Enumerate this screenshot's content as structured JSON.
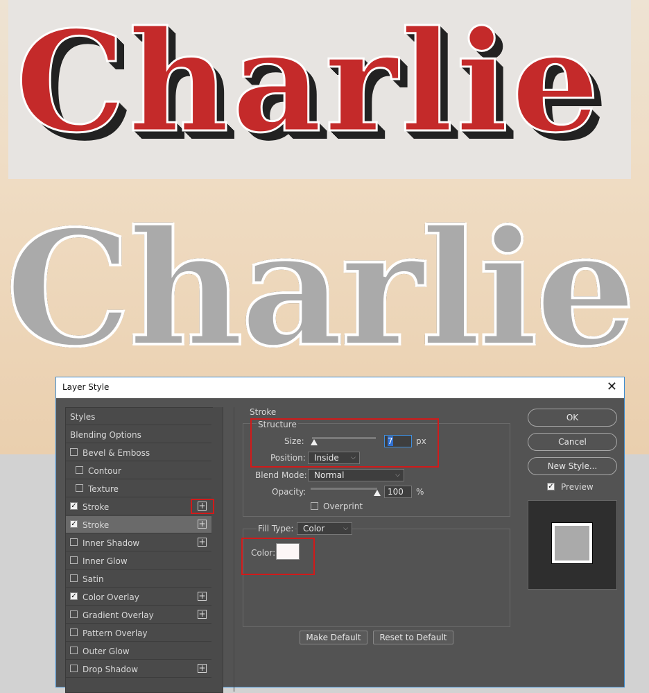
{
  "canvas": {
    "word_top": "Charlie",
    "word_bottom": "Charlie"
  },
  "dialog": {
    "title": "Layer Style",
    "styles_list": [
      {
        "label": "Styles",
        "has_checkbox": false,
        "checked": false,
        "plus": false,
        "indent": false,
        "selected": false
      },
      {
        "label": "Blending Options",
        "has_checkbox": false,
        "checked": false,
        "plus": false,
        "indent": false,
        "selected": false
      },
      {
        "label": "Bevel & Emboss",
        "has_checkbox": true,
        "checked": false,
        "plus": false,
        "indent": false,
        "selected": false
      },
      {
        "label": "Contour",
        "has_checkbox": true,
        "checked": false,
        "plus": false,
        "indent": true,
        "selected": false
      },
      {
        "label": "Texture",
        "has_checkbox": true,
        "checked": false,
        "plus": false,
        "indent": true,
        "selected": false
      },
      {
        "label": "Stroke",
        "has_checkbox": true,
        "checked": true,
        "plus": true,
        "indent": false,
        "selected": false
      },
      {
        "label": "Stroke",
        "has_checkbox": true,
        "checked": true,
        "plus": true,
        "indent": false,
        "selected": true
      },
      {
        "label": "Inner Shadow",
        "has_checkbox": true,
        "checked": false,
        "plus": true,
        "indent": false,
        "selected": false
      },
      {
        "label": "Inner Glow",
        "has_checkbox": true,
        "checked": false,
        "plus": false,
        "indent": false,
        "selected": false
      },
      {
        "label": "Satin",
        "has_checkbox": true,
        "checked": false,
        "plus": false,
        "indent": false,
        "selected": false
      },
      {
        "label": "Color Overlay",
        "has_checkbox": true,
        "checked": true,
        "plus": true,
        "indent": false,
        "selected": false
      },
      {
        "label": "Gradient Overlay",
        "has_checkbox": true,
        "checked": false,
        "plus": true,
        "indent": false,
        "selected": false
      },
      {
        "label": "Pattern Overlay",
        "has_checkbox": true,
        "checked": false,
        "plus": false,
        "indent": false,
        "selected": false
      },
      {
        "label": "Outer Glow",
        "has_checkbox": true,
        "checked": false,
        "plus": false,
        "indent": false,
        "selected": false
      },
      {
        "label": "Drop Shadow",
        "has_checkbox": true,
        "checked": false,
        "plus": true,
        "indent": false,
        "selected": false
      }
    ],
    "stroke": {
      "section_label": "Stroke",
      "structure_label": "Structure",
      "size_label": "Size:",
      "size_value": "7",
      "size_unit": "px",
      "position_label": "Position:",
      "position_value": "Inside",
      "blend_mode_label": "Blend Mode:",
      "blend_mode_value": "Normal",
      "opacity_label": "Opacity:",
      "opacity_value": "100",
      "opacity_unit": "%",
      "overprint_label": "Overprint",
      "fill_type_label": "Fill Type:",
      "fill_type_value": "Color",
      "color_label": "Color:",
      "color_value": "#fcf7f7"
    },
    "buttons": {
      "make_default": "Make Default",
      "reset_to_default": "Reset to Default",
      "ok": "OK",
      "cancel": "Cancel",
      "new_style": "New Style...",
      "preview_label": "Preview"
    }
  }
}
